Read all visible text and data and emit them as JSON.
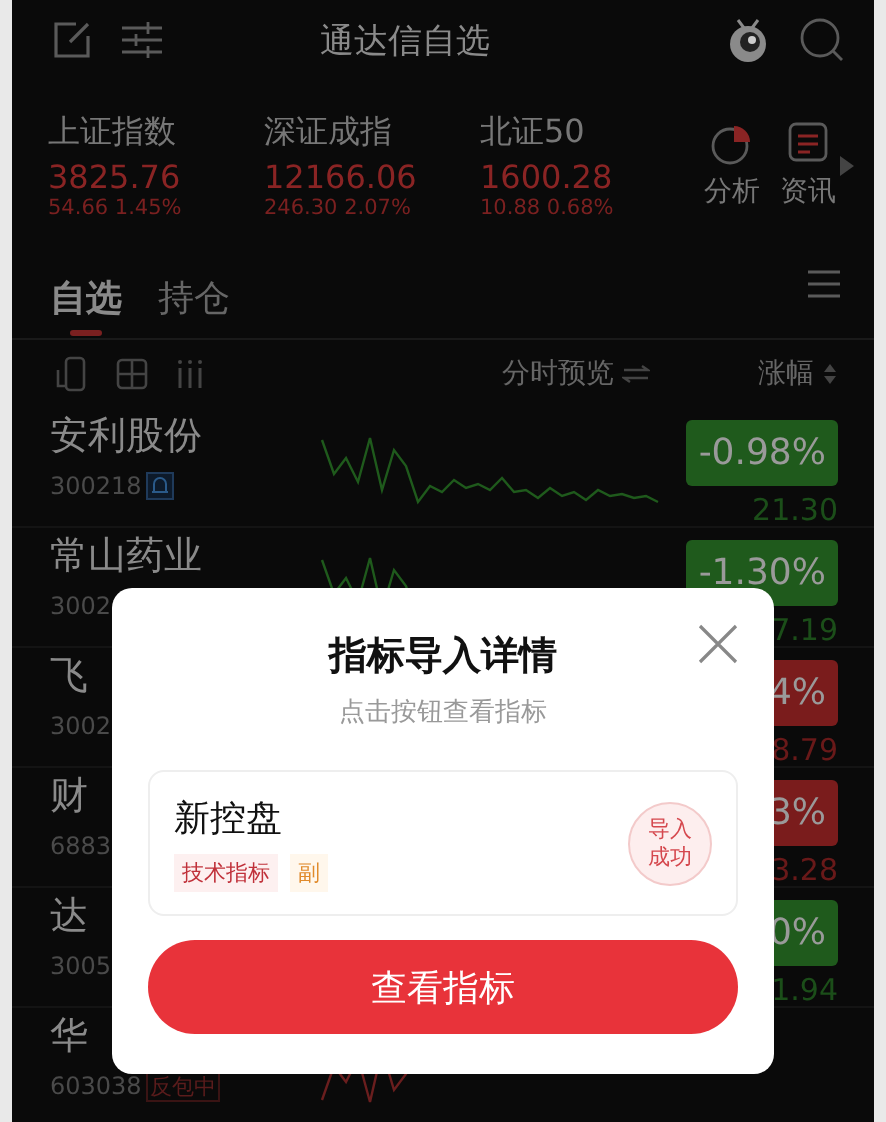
{
  "header": {
    "title": "通达信自选"
  },
  "indices": [
    {
      "name": "上证指数",
      "value": "3825.76",
      "change": "54.66",
      "percent": "1.45%"
    },
    {
      "name": "深证成指",
      "value": "12166.06",
      "change": "246.30",
      "percent": "2.07%"
    },
    {
      "name": "北证50",
      "value": "1600.28",
      "change": "10.88",
      "percent": "0.68%"
    }
  ],
  "tools": [
    {
      "label": "分析",
      "kind": "chart"
    },
    {
      "label": "资讯",
      "kind": "news"
    }
  ],
  "tabs": [
    {
      "label": "自选",
      "selected": true
    },
    {
      "label": "持仓",
      "selected": false
    }
  ],
  "list_header": {
    "preview": "分时预览",
    "sort": "涨幅"
  },
  "stocks": [
    {
      "name": "安利股份",
      "code": "300218",
      "alert": true,
      "change_pct": "-0.98%",
      "price": "21.30",
      "color": "#1f5a1c",
      "sparkline": true
    },
    {
      "name": "常山药业",
      "code": "3002",
      "change_pct": "-1.30%",
      "price": "7.19",
      "color": "#1f5a1c",
      "sparkline": true
    },
    {
      "name": "飞",
      "code": "3002",
      "change_pct": "4%",
      "price": "8.79",
      "color": "#7a1c1c"
    },
    {
      "name": "财",
      "code": "6883",
      "change_pct": "3%",
      "price": "3.28",
      "color": "#7a1c1c"
    },
    {
      "name": "达",
      "code": "3005",
      "change_pct": "0%",
      "price": "1.94",
      "color": "#1f5a1c"
    },
    {
      "name": "华",
      "code": "603038",
      "badge": "反包中",
      "sparkline": true
    }
  ],
  "dialog": {
    "title": "指标导入详情",
    "subtitle": "点击按钮查看指标",
    "indicator": {
      "name": "新控盘",
      "tags": [
        {
          "label": "技术指标",
          "kind": "category"
        },
        {
          "label": "副",
          "kind": "position"
        }
      ],
      "status": [
        "导入",
        "成功"
      ]
    },
    "button": "查看指标"
  }
}
